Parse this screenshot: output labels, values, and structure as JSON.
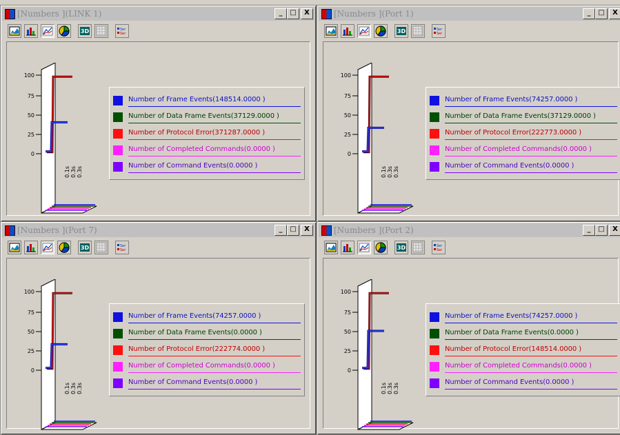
{
  "windows": [
    {
      "title": "[Numbers ](LINK 1)",
      "plot": {
        "hx": 37,
        "hy": 40
      },
      "legend": [
        {
          "text": "Number of Frame Events(148514.0000 )",
          "color": "#1010e0",
          "text_color": "#1010c0"
        },
        {
          "text": "Number of Data Frame Events(37129.0000 )",
          "color": "#005000",
          "text_color": "#004000"
        },
        {
          "text": "Number of Protocol Error(371287.0000 )",
          "color": "#ff1010",
          "text_color": "#c00000"
        },
        {
          "text": "Number of Completed Commands(0.0000 )",
          "color": "#ff20ff",
          "text_color": "#d000d0"
        },
        {
          "text": "Number of Command Events(0.0000 )",
          "color": "#8000ff",
          "text_color": "#5000c0"
        }
      ]
    },
    {
      "title": "[Numbers ](Port 1)",
      "plot": {
        "hx": 32,
        "hy": 33
      },
      "legend": [
        {
          "text": "Number of Frame Events(74257.0000 )",
          "color": "#1010e0",
          "text_color": "#1010c0"
        },
        {
          "text": "Number of Data Frame Events(37129.0000 )",
          "color": "#005000",
          "text_color": "#004000"
        },
        {
          "text": "Number of Protocol Error(222773.0000 )",
          "color": "#ff1010",
          "text_color": "#c00000"
        },
        {
          "text": "Number of Completed Commands(0.0000 )",
          "color": "#ff20ff",
          "text_color": "#d000d0"
        },
        {
          "text": "Number of Command Events(0.0000 )",
          "color": "#8000ff",
          "text_color": "#5000c0"
        }
      ]
    },
    {
      "title": "[Numbers ](Port 7)",
      "plot": {
        "hx": 34,
        "hy": 33
      },
      "legend": [
        {
          "text": "Number of Frame Events(74257.0000 )",
          "color": "#1010e0",
          "text_color": "#1010c0"
        },
        {
          "text": "Number of Data Frame Events(0.0000 )",
          "color": "#005000",
          "text_color": "#004000"
        },
        {
          "text": "Number of Protocol Error(222774.0000 )",
          "color": "#ff1010",
          "text_color": "#c00000"
        },
        {
          "text": "Number of Completed Commands(0.0000 )",
          "color": "#ff20ff",
          "text_color": "#d000d0"
        },
        {
          "text": "Number of Command Events(0.0000 )",
          "color": "#8000ff",
          "text_color": "#5000c0"
        }
      ]
    },
    {
      "title": "[Numbers ](Port 2)",
      "plot": {
        "hx": 34,
        "hy": 50
      },
      "legend": [
        {
          "text": "Number of Frame Events(74257.0000 )",
          "color": "#1010e0",
          "text_color": "#1010c0"
        },
        {
          "text": "Number of Data Frame Events(0.0000 )",
          "color": "#005000",
          "text_color": "#004000"
        },
        {
          "text": "Number of Protocol Error(148514.0000 )",
          "color": "#ff1010",
          "text_color": "#c00000"
        },
        {
          "text": "Number of Completed Commands(0.0000 )",
          "color": "#ff20ff",
          "text_color": "#d000d0"
        },
        {
          "text": "Number of Command Events(0.0000 )",
          "color": "#8000ff",
          "text_color": "#5000c0"
        }
      ]
    }
  ],
  "y_ticks": [
    "100",
    "75",
    "50",
    "25",
    "0"
  ],
  "x_ticks": [
    "0.1s",
    "0.3s",
    "0.3s"
  ],
  "window_buttons": {
    "minimize": "_",
    "maximize": "□",
    "close": "X"
  },
  "toolbar_icons": [
    "area-chart-icon",
    "bar-chart-icon",
    "line-chart-icon",
    "pie-chart-icon",
    "3d-toggle-icon",
    "grid-icon",
    "series-icon"
  ],
  "toolbar_3d_label": "3D",
  "toolbar_series_label": "Ser"
}
